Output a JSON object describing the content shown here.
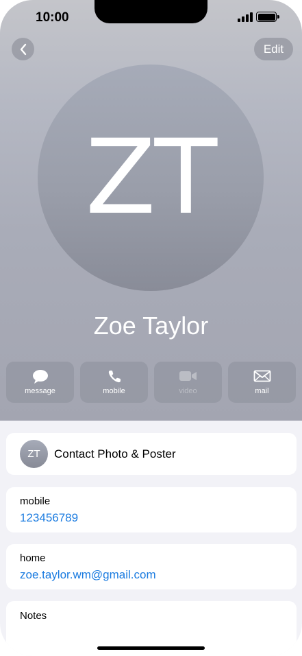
{
  "status_bar": {
    "time": "10:00"
  },
  "nav": {
    "back_icon": "chevron-left-icon",
    "edit_label": "Edit"
  },
  "contact": {
    "initials": "ZT",
    "name": "Zoe Taylor"
  },
  "actions": [
    {
      "label": "message",
      "icon": "message-bubble-icon",
      "enabled": true
    },
    {
      "label": "mobile",
      "icon": "phone-icon",
      "enabled": true
    },
    {
      "label": "video",
      "icon": "video-camera-icon",
      "enabled": false
    },
    {
      "label": "mail",
      "icon": "envelope-icon",
      "enabled": true
    }
  ],
  "poster_card": {
    "initials": "ZT",
    "title": "Contact Photo & Poster"
  },
  "fields": {
    "mobile": {
      "label": "mobile",
      "value": "123456789"
    },
    "home": {
      "label": "home",
      "value": "zoe.taylor.wm@gmail.com"
    }
  },
  "notes": {
    "label": "Notes"
  },
  "colors": {
    "link": "#1a7be0",
    "background": "#f2f2f7"
  }
}
